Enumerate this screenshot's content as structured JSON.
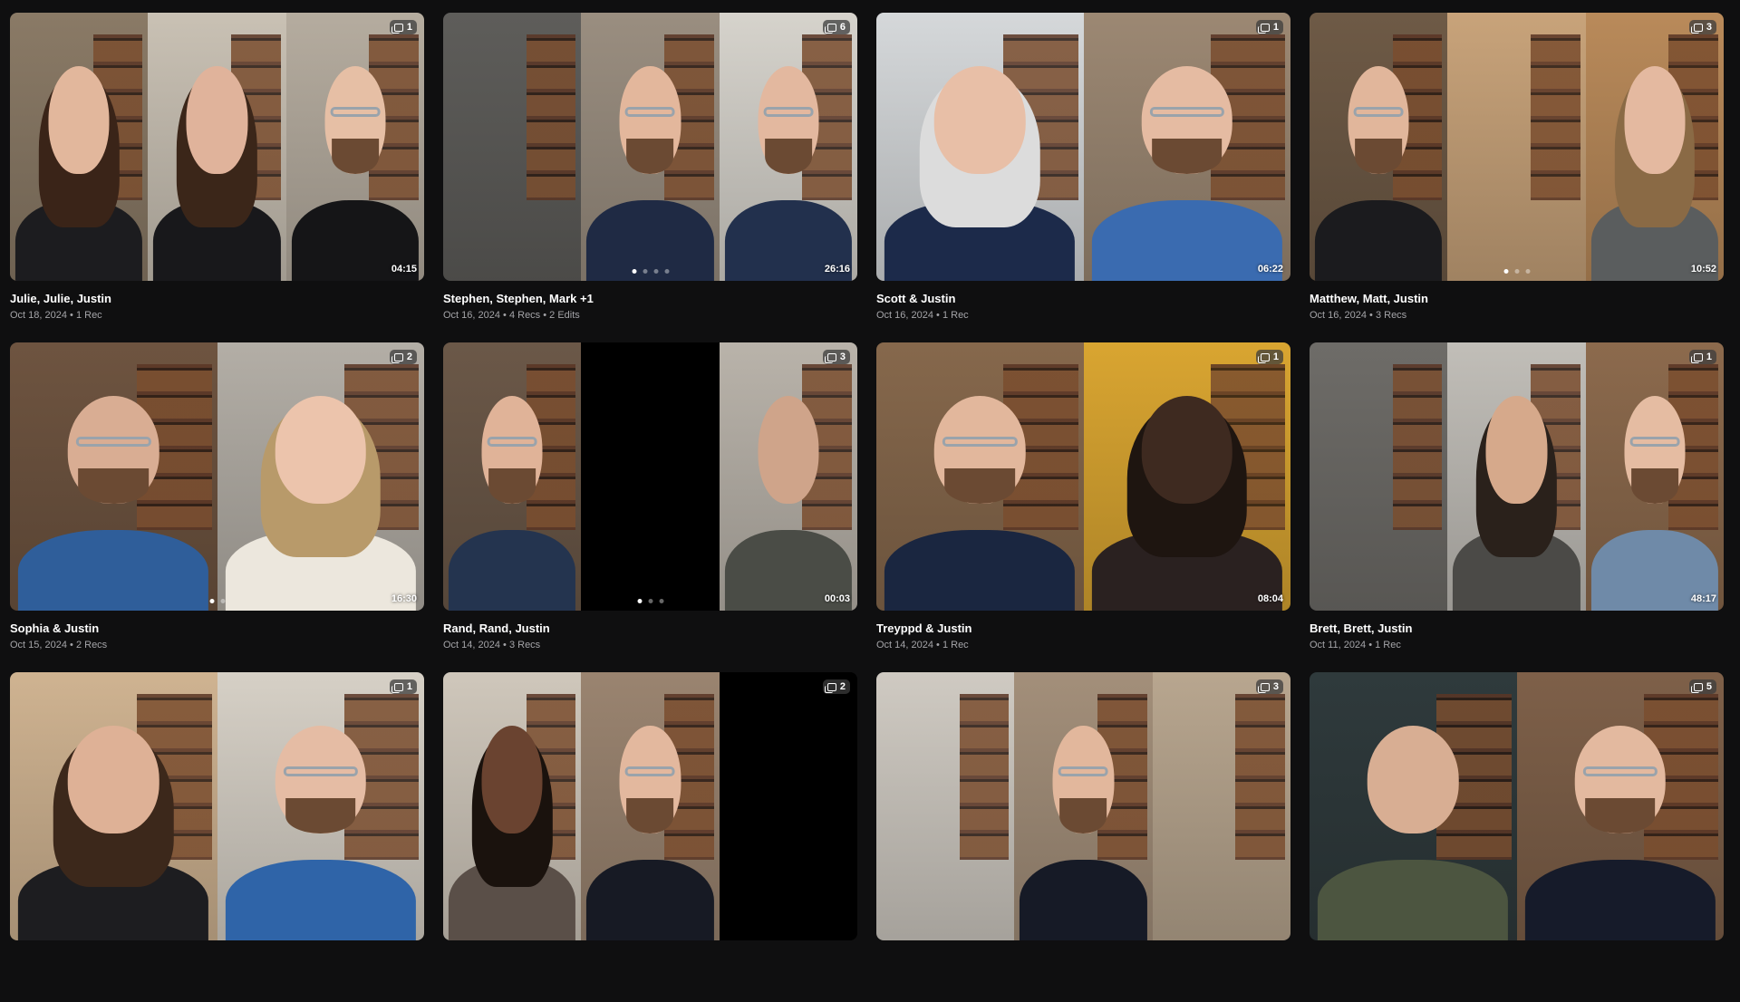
{
  "cards": [
    {
      "title": "Julie, Julie, Justin",
      "meta": "Oct 18, 2024 • 1 Rec",
      "count": "1",
      "duration": "04:15",
      "dots": 0,
      "active": 0,
      "frames": [
        {
          "wall": "#8a7a66",
          "skin": "#e2b79c",
          "hair": "#3a2418",
          "shirt": "#1c1c1f",
          "beard": false
        },
        {
          "wall": "#c9c1b4",
          "skin": "#e0b39b",
          "hair": "#3b2619",
          "shirt": "#18181b",
          "beard": false
        },
        {
          "wall": "#b5ac9f",
          "skin": "#e6bfa5",
          "hair": "",
          "shirt": "#151517",
          "beard": true
        }
      ]
    },
    {
      "title": "Stephen, Stephen, Mark +1",
      "meta": "Oct 16, 2024 • 4 Recs • 2 Edits",
      "count": "6",
      "duration": "26:16",
      "dots": 4,
      "active": 0,
      "frames": [
        {
          "wall": "#5e5d5a",
          "skin": "",
          "hair": "",
          "shirt": "",
          "beard": false
        },
        {
          "wall": "#9a8e80",
          "skin": "#e3b79c",
          "hair": "",
          "shirt": "#1f2a44",
          "beard": true
        },
        {
          "wall": "#d6d3cc",
          "skin": "#e3b89f",
          "hair": "",
          "shirt": "#22304d",
          "beard": true
        }
      ]
    },
    {
      "title": "Scott & Justin",
      "meta": "Oct 16, 2024 • 1 Rec",
      "count": "1",
      "duration": "06:22",
      "dots": 0,
      "active": 0,
      "frames": [
        {
          "wall": "#d5d8da",
          "skin": "#e8bfa7",
          "hair": "#dcdcdc",
          "shirt": "#1c2a4a",
          "beard": false
        },
        {
          "wall": "#9c8873",
          "skin": "#e5bba2",
          "hair": "",
          "shirt": "#3a6bb0",
          "beard": true
        }
      ]
    },
    {
      "title": "Matthew, Matt, Justin",
      "meta": "Oct 16, 2024 • 3 Recs",
      "count": "3",
      "duration": "10:52",
      "dots": 3,
      "active": 0,
      "frames": [
        {
          "wall": "#6e5a46",
          "skin": "#e1b69b",
          "hair": "",
          "shirt": "#1b1b1e",
          "beard": true
        },
        {
          "wall": "#c8a37a",
          "skin": "",
          "hair": "",
          "shirt": "",
          "beard": false
        },
        {
          "wall": "#b98a5a",
          "skin": "#e4b9a0",
          "hair": "#8a6a45",
          "shirt": "#5a5d5e",
          "beard": false
        }
      ]
    },
    {
      "title": "Sophia & Justin",
      "meta": "Oct 15, 2024 • 2 Recs",
      "count": "2",
      "duration": "16:30",
      "dots": 2,
      "active": 0,
      "frames": [
        {
          "wall": "#6e5440",
          "skin": "#d9ad93",
          "hair": "",
          "shirt": "#2f5e9a",
          "beard": true
        },
        {
          "wall": "#b3aea6",
          "skin": "#ecc4ac",
          "hair": "#b89a6a",
          "shirt": "#ece7dd",
          "beard": false
        }
      ]
    },
    {
      "title": "Rand, Rand, Justin",
      "meta": "Oct 14, 2024 • 3 Recs",
      "count": "3",
      "duration": "00:03",
      "dots": 3,
      "active": 0,
      "frames": [
        {
          "wall": "#6b5848",
          "skin": "#e0b398",
          "hair": "",
          "shirt": "#24344f",
          "beard": true
        },
        {
          "wall": "#000000",
          "skin": "",
          "hair": "",
          "shirt": "",
          "beard": false
        },
        {
          "wall": "#b9b3aa",
          "skin": "#cfa48a",
          "hair": "",
          "shirt": "#4a4c46",
          "beard": false
        }
      ]
    },
    {
      "title": "Treyppd & Justin",
      "meta": "Oct 14, 2024 • 1 Rec",
      "count": "1",
      "duration": "08:04",
      "dots": 0,
      "active": 0,
      "frames": [
        {
          "wall": "#86684c",
          "skin": "#e2b79c",
          "hair": "",
          "shirt": "#1a2640",
          "beard": true
        },
        {
          "wall": "#d9a531",
          "skin": "#3e2a20",
          "hair": "#1e1510",
          "shirt": "#2a2120",
          "beard": false
        }
      ]
    },
    {
      "title": "Brett, Brett, Justin",
      "meta": "Oct 11, 2024 • 1 Rec",
      "count": "1",
      "duration": "48:17",
      "dots": 0,
      "active": 0,
      "frames": [
        {
          "wall": "#6e6c68",
          "skin": "",
          "hair": "",
          "shirt": "",
          "beard": false
        },
        {
          "wall": "#c1beb8",
          "skin": "#d6a98b",
          "hair": "#2a211b",
          "shirt": "#4b4a47",
          "beard": false
        },
        {
          "wall": "#8c6a4d",
          "skin": "#e5bca2",
          "hair": "",
          "shirt": "#6f8aa8",
          "beard": true
        }
      ]
    },
    {
      "title": "",
      "meta": "",
      "count": "1",
      "duration": "",
      "dots": 0,
      "active": 0,
      "frames": [
        {
          "wall": "#cfb391",
          "skin": "#deb196",
          "hair": "#3c281b",
          "shirt": "#1d1d20",
          "beard": false
        },
        {
          "wall": "#d6d0c6",
          "skin": "#e5bca4",
          "hair": "",
          "shirt": "#2f64a8",
          "beard": true
        }
      ]
    },
    {
      "title": "",
      "meta": "",
      "count": "2",
      "duration": "",
      "dots": 0,
      "active": 0,
      "frames": [
        {
          "wall": "#cfc7bb",
          "skin": "#6a4330",
          "hair": "#1a120d",
          "shirt": "#5a4f48",
          "beard": false
        },
        {
          "wall": "#9a8470",
          "skin": "#e3b89e",
          "hair": "",
          "shirt": "#171a24",
          "beard": true
        },
        {
          "wall": "#000000",
          "skin": "",
          "hair": "",
          "shirt": "",
          "beard": false
        }
      ]
    },
    {
      "title": "",
      "meta": "",
      "count": "3",
      "duration": "",
      "dots": 0,
      "active": 0,
      "frames": [
        {
          "wall": "#cfcac2",
          "skin": "",
          "hair": "",
          "shirt": "",
          "beard": false
        },
        {
          "wall": "#a38f7a",
          "skin": "#e2b79c",
          "hair": "",
          "shirt": "#161a26",
          "beard": true
        },
        {
          "wall": "#b8a68f",
          "skin": "",
          "hair": "",
          "shirt": "",
          "beard": false
        }
      ]
    },
    {
      "title": "",
      "meta": "",
      "count": "5",
      "duration": "",
      "dots": 0,
      "active": 0,
      "frames": [
        {
          "wall": "#2f3a3c",
          "skin": "#d8ae93",
          "hair": "",
          "shirt": "#4c5540",
          "beard": false
        },
        {
          "wall": "#7e6049",
          "skin": "#e3b99f",
          "hair": "",
          "shirt": "#161b2a",
          "beard": true
        }
      ]
    }
  ]
}
